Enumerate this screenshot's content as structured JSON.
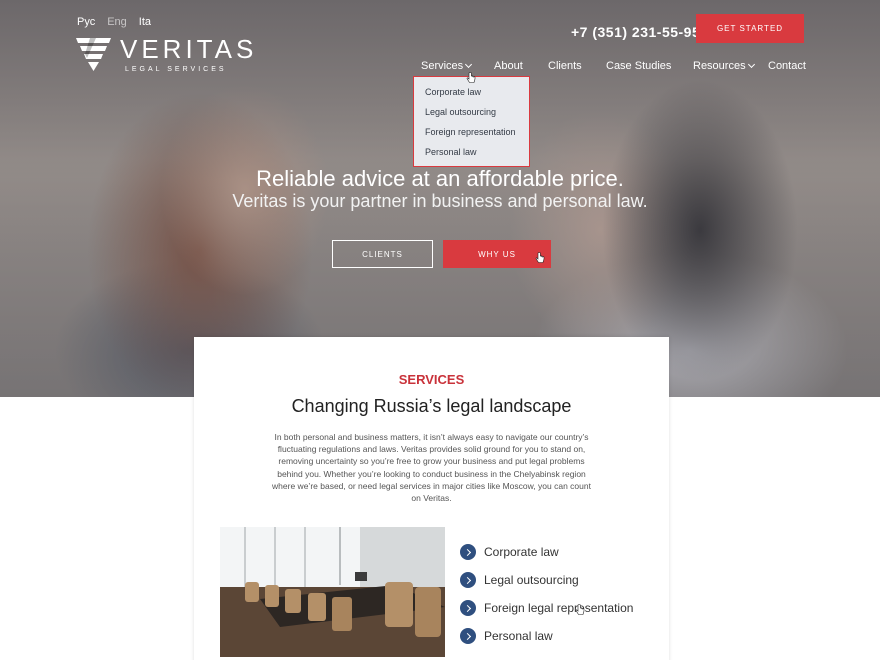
{
  "header": {
    "languages": [
      {
        "label": "Рус",
        "active": true
      },
      {
        "label": "Eng",
        "active": false
      },
      {
        "label": "Ita",
        "active": true
      }
    ],
    "logo": {
      "word": "VERITAS",
      "tagline": "LEGAL SERVICES",
      "icon": "veritas-v-logo"
    },
    "phone": "+7 (351) 231-55-95",
    "cta_label": "GET STARTED"
  },
  "nav": {
    "items": [
      {
        "label": "Services",
        "has_dropdown": true
      },
      {
        "label": "About",
        "has_dropdown": false
      },
      {
        "label": "Clients",
        "has_dropdown": false
      },
      {
        "label": "Case Studies",
        "has_dropdown": false
      },
      {
        "label": "Resources",
        "has_dropdown": true
      },
      {
        "label": "Contact",
        "has_dropdown": false
      }
    ],
    "dropdown": [
      "Corporate law",
      "Legal outsourcing",
      "Foreign representation",
      "Personal law"
    ]
  },
  "hero": {
    "title": "Reliable advice at an affordable price.",
    "subtitle": "Veritas is your partner in business and personal law.",
    "btn_clients": "CLIENTS",
    "btn_why": "WHY US"
  },
  "services": {
    "eyebrow": "SERVICES",
    "title": "Changing Russia’s legal landscape",
    "body": "In both personal and business matters, it isn’t always easy to navigate our country’s fluctuating regulations and laws. Veritas provides solid ground for you to stand on, removing uncertainty so you’re free to grow your business and put legal problems behind you. Whether you’re looking to conduct business in the Chelyabinsk region where we’re based, or need legal services in major cities like Moscow, you can count on Veritas.",
    "items": [
      "Corporate law",
      "Legal outsourcing",
      "Foreign legal representation",
      "Personal law"
    ]
  },
  "colors": {
    "accent": "#d93a3f",
    "icon_blue": "#2f4f7f",
    "text": "#333333"
  }
}
